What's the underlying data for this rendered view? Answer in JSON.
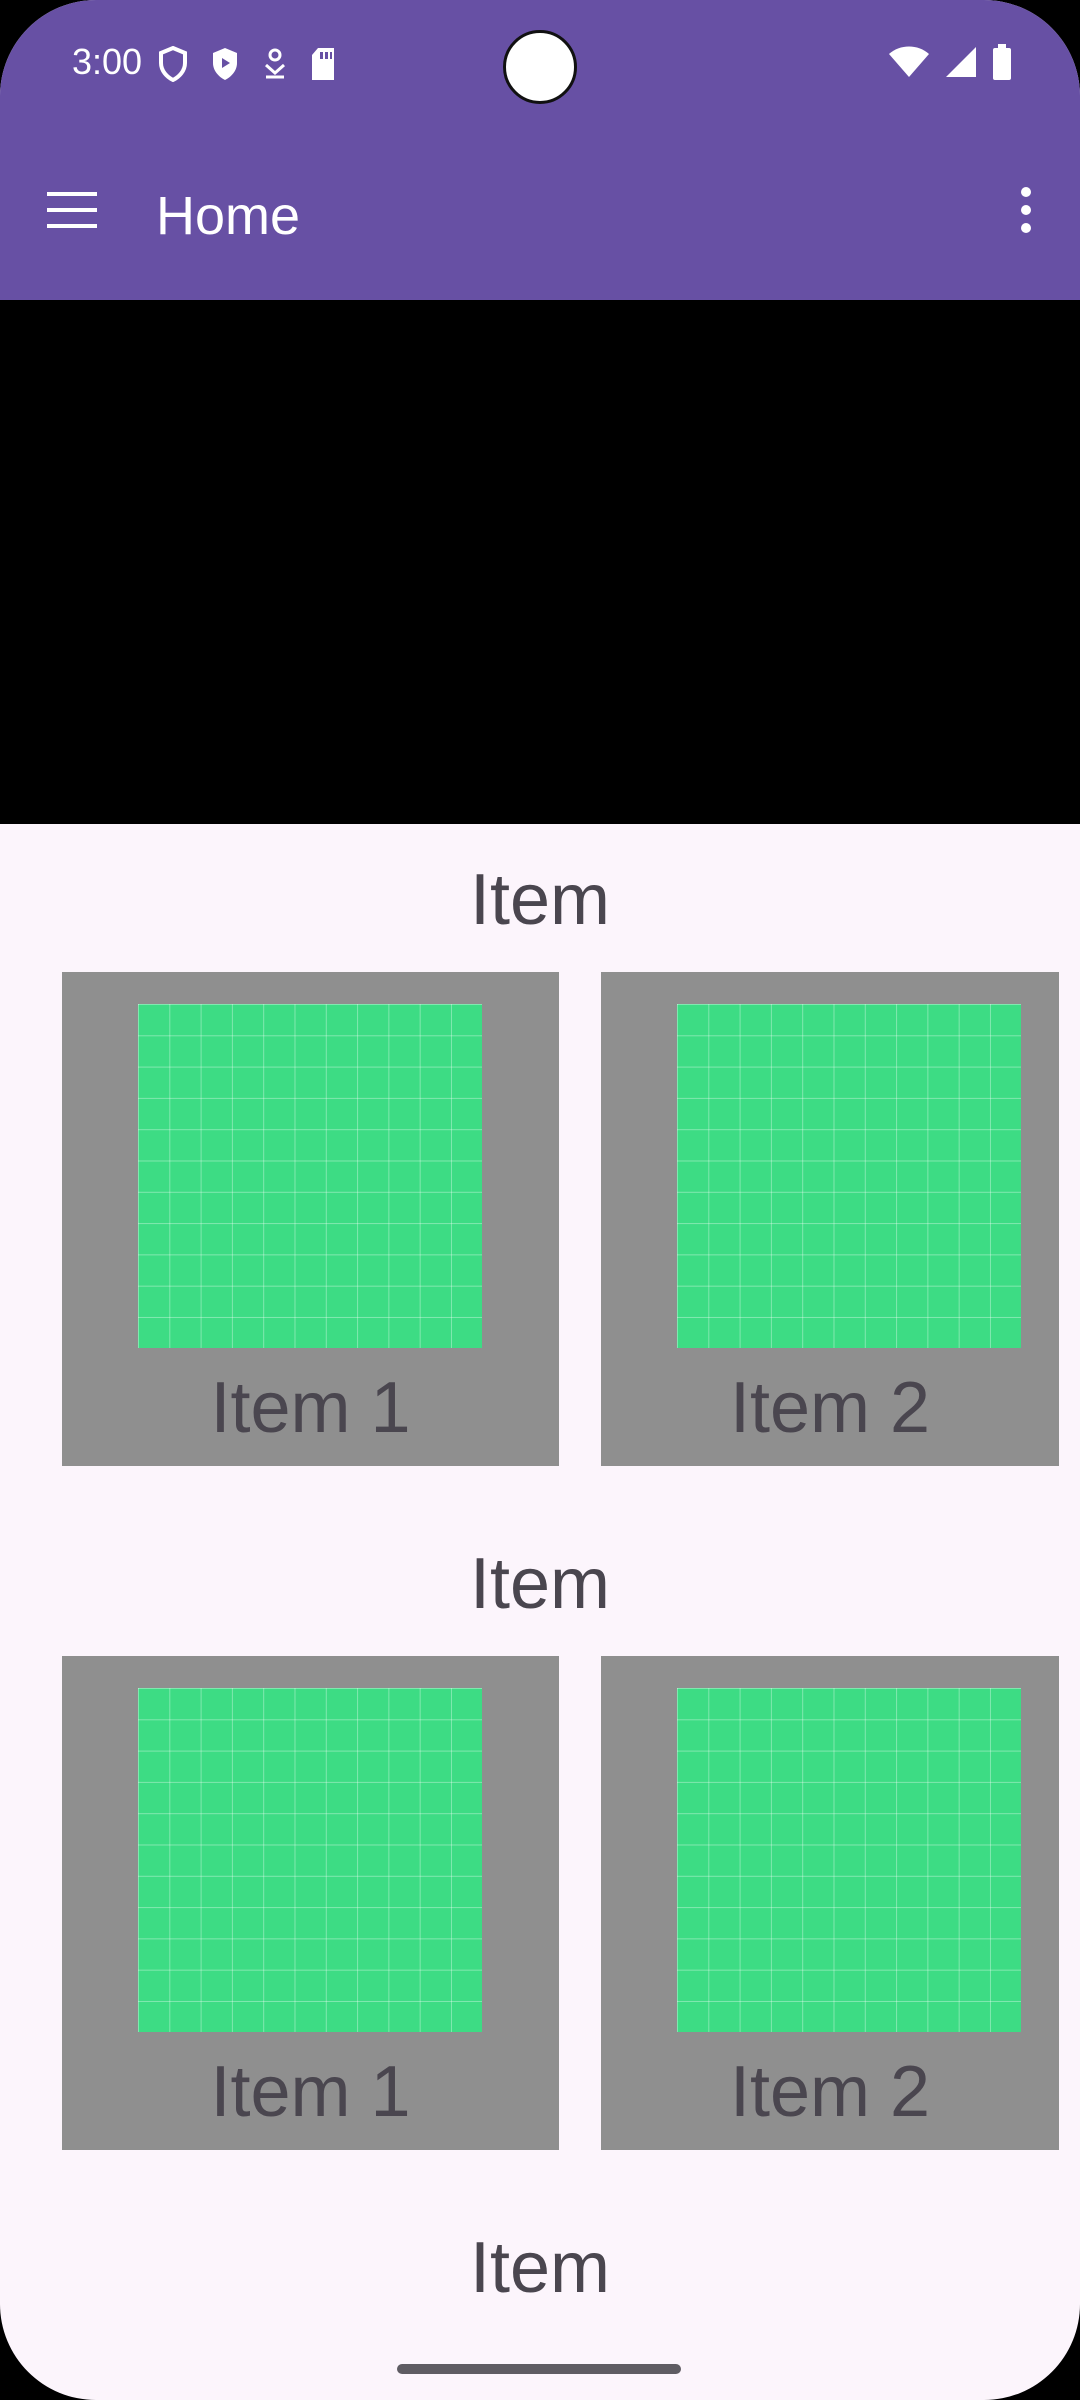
{
  "status_bar": {
    "time": "3:00",
    "left_icons": [
      "shield-icon",
      "play-protect-icon",
      "download-icon",
      "sd-card-icon"
    ],
    "right_icons": [
      "wifi-icon",
      "signal-icon",
      "battery-icon"
    ]
  },
  "app_bar": {
    "title": "Home",
    "menu_icon": "hamburger-menu-icon",
    "overflow_icon": "more-vert-icon"
  },
  "sections": [
    {
      "title": "Item",
      "cards": [
        {
          "label": "Item 1"
        },
        {
          "label": "Item 2"
        }
      ]
    },
    {
      "title": "Item",
      "cards": [
        {
          "label": "Item 1"
        },
        {
          "label": "Item 2"
        }
      ]
    },
    {
      "title": "Item"
    }
  ],
  "colors": {
    "primary": "#6750A4",
    "background": "#FCF5FC",
    "card": "#8F8F8F",
    "thumbnail": "#3DDC84",
    "text": "#4A464F"
  }
}
